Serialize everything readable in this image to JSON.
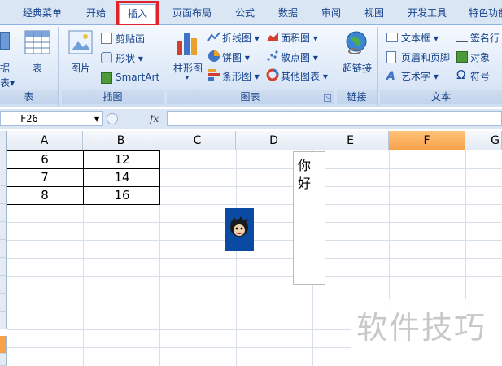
{
  "tabs": [
    "经典菜单",
    "开始",
    "插入",
    "页面布局",
    "公式",
    "数据",
    "审阅",
    "视图",
    "开发工具",
    "特色功能"
  ],
  "active_tab": "插入",
  "ribbon": {
    "tables_group": {
      "pivot_label_1": "据",
      "pivot_label_2": "表",
      "pivot_arrow": "表▾",
      "table_label": "表",
      "title": "表"
    },
    "illustrations_group": {
      "picture_label": "图片",
      "clipart_label": "剪贴画",
      "shapes_label": "形状 ▾",
      "smartart_label": "SmartArt",
      "title": "插图"
    },
    "charts_group": {
      "column_label": "柱形图",
      "column_arrow": "▾",
      "line_label": "折线图 ▾",
      "pie_label": "饼图 ▾",
      "bar_label": "条形图 ▾",
      "area_label": "面积图 ▾",
      "scatter_label": "散点图 ▾",
      "other_label": "其他图表 ▾",
      "title": "图表"
    },
    "links_group": {
      "hyperlink_label": "超链接",
      "title": "链接"
    },
    "text_group": {
      "textbox_label": "文本框 ▾",
      "header_footer_label": "页眉和页脚",
      "wordart_label": "艺术字 ▾",
      "signature_label": "签名行",
      "object_label": "对象",
      "symbol_label": "符号",
      "title": "文本"
    }
  },
  "formula_bar": {
    "name_box": "F26",
    "fx": "fx",
    "formula": ""
  },
  "columns": [
    "A",
    "B",
    "C",
    "D",
    "E",
    "F",
    "G"
  ],
  "selected_column": "F",
  "table_rows": [
    {
      "a": "6",
      "b": "12"
    },
    {
      "a": "7",
      "b": "14"
    },
    {
      "a": "8",
      "b": "16"
    }
  ],
  "textbox_text": [
    "你",
    "好"
  ],
  "watermark": "软件技巧",
  "colors": {
    "tab_highlight": "#e0222a",
    "selected_header": "#f7a24a",
    "ribbon_text": "#15428b"
  }
}
